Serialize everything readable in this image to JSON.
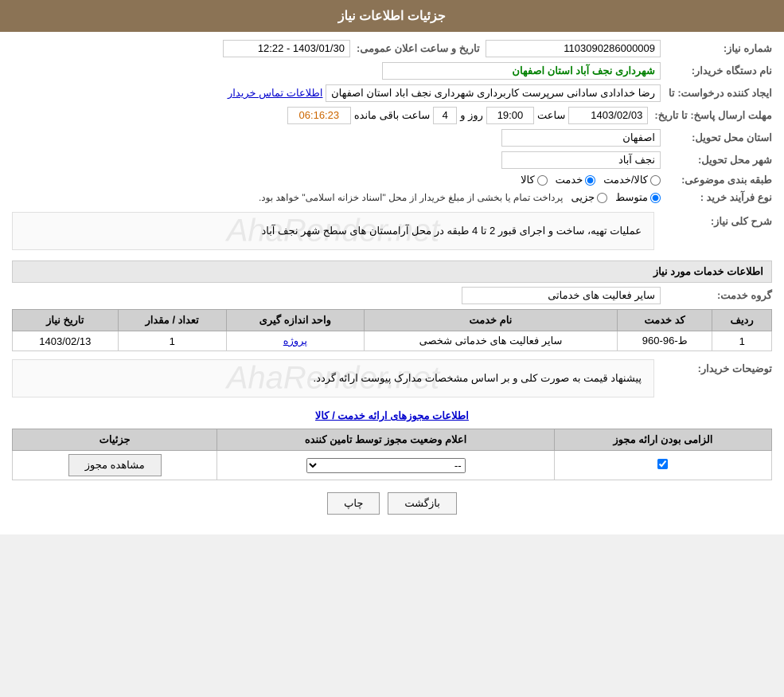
{
  "header": {
    "title": "جزئیات اطلاعات نیاز"
  },
  "fields": {
    "order_number_label": "شماره نیاز:",
    "order_number_value": "1103090286000009",
    "buyer_org_label": "نام دستگاه خریدار:",
    "buyer_org_value": "شهرداری نجف آباد استان اصفهان",
    "creator_label": "ایجاد کننده درخواست: تا",
    "creator_value": "رضا خدادادی سادانی سرپرست  کاربرداری شهرداری نجف اباد استان اصفهان",
    "contact_link": "اطلاعات تماس خریدار",
    "deadline_label": "مهلت ارسال پاسخ: تا تاریخ:",
    "deadline_date": "1403/02/03",
    "deadline_time_label": "ساعت",
    "deadline_time": "19:00",
    "deadline_days_label": "روز و",
    "deadline_days": "4",
    "deadline_remaining_label": "ساعت باقی مانده",
    "deadline_remaining": "06:16:23",
    "delivery_province_label": "استان محل تحویل:",
    "delivery_province_value": "اصفهان",
    "delivery_city_label": "شهر محل تحویل:",
    "delivery_city_value": "نجف آباد",
    "subject_label": "طبقه بندی موضوعی:",
    "subject_options": [
      "کالا",
      "خدمت",
      "کالا/خدمت"
    ],
    "subject_selected": "خدمت",
    "purchase_type_label": "نوع فرآیند خرید :",
    "purchase_type_note": "پرداخت تمام یا بخشی از مبلغ خریدار از محل \"اسناد خزانه اسلامی\" خواهد بود.",
    "purchase_type_options": [
      "جزیی",
      "متوسط"
    ],
    "purchase_type_selected": "متوسط",
    "announce_date_label": "تاریخ و ساعت اعلان عمومی:",
    "announce_date_value": "1403/01/30 - 12:22",
    "description_label": "شرح کلی نیاز:",
    "description_value": "عملیات تهیه، ساخت و اجرای قبور 2 تا 4 طبقه در محل آرامستان های سطح شهر نجف آباد",
    "services_section_title": "اطلاعات خدمات مورد نیاز",
    "service_group_label": "گروه خدمت:",
    "service_group_value": "سایر فعالیت های خدماتی",
    "table": {
      "headers": [
        "ردیف",
        "کد خدمت",
        "نام خدمت",
        "واحد اندازه گیری",
        "تعداد / مقدار",
        "تاریخ نیاز"
      ],
      "rows": [
        {
          "row_num": "1",
          "service_code": "ط-96-960",
          "service_name": "سایر فعالیت های خدماتی شخصی",
          "unit": "پروژه",
          "quantity": "1",
          "date": "1403/02/13"
        }
      ]
    },
    "buyer_notes_label": "توضیحات خریدار:",
    "buyer_notes_value": "پیشنهاد قیمت به صورت کلی و بر اساس مشخصات مدارک پیوست ارائه گردد.",
    "license_title": "اطلاعات مجوزهای ارائه خدمت / کالا",
    "license_table": {
      "headers": [
        "الزامی بودن ارائه مجوز",
        "اعلام وضعیت مجوز توسط تامین کننده",
        "جزئیات"
      ],
      "rows": [
        {
          "required": "✓",
          "status": "--",
          "details_btn": "مشاهده مجوز"
        }
      ]
    }
  },
  "buttons": {
    "print": "چاپ",
    "back": "بازگشت"
  }
}
